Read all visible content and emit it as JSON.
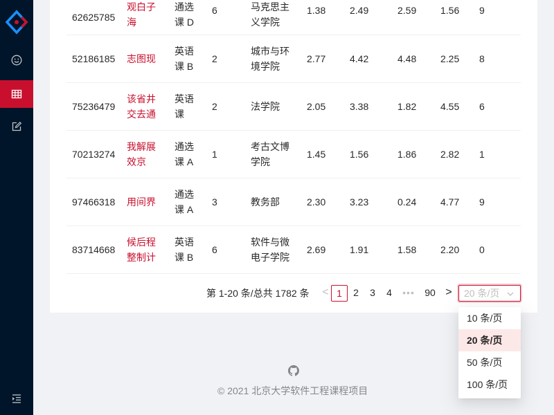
{
  "sidebar": {
    "logo_icon": "react-logo-icon",
    "items": [
      {
        "icon": "smile-icon",
        "active": false
      },
      {
        "icon": "table-icon",
        "active": true
      },
      {
        "icon": "edit-icon",
        "active": false
      }
    ],
    "collapse_icon": "menu-unfold-icon"
  },
  "colors": {
    "accent": "#c8102e",
    "sidebar": "#001529",
    "background": "#f0f2f5"
  },
  "table": {
    "rows": [
      {
        "id": "62625785",
        "name": "观白子海",
        "type": "通选课 D",
        "credit": "6",
        "dept": "马克思主义学院",
        "a": "1.38",
        "b": "2.49",
        "c": "2.59",
        "d": "1.56",
        "e": "9"
      },
      {
        "id": "52186185",
        "name": "志图现",
        "type": "英语课 B",
        "credit": "2",
        "dept": "城市与环境学院",
        "a": "2.77",
        "b": "4.42",
        "c": "4.48",
        "d": "2.25",
        "e": "8"
      },
      {
        "id": "75236479",
        "name": "该省井交去通",
        "type": "英语课",
        "credit": "2",
        "dept": "法学院",
        "a": "2.05",
        "b": "3.38",
        "c": "1.82",
        "d": "4.55",
        "e": "6"
      },
      {
        "id": "70213274",
        "name": "我解展效京",
        "type": "通选课 A",
        "credit": "1",
        "dept": "考古文博学院",
        "a": "1.45",
        "b": "1.56",
        "c": "1.86",
        "d": "2.82",
        "e": "1"
      },
      {
        "id": "97466318",
        "name": "用间界",
        "type": "通选课 A",
        "credit": "3",
        "dept": "教务部",
        "a": "2.30",
        "b": "3.23",
        "c": "0.24",
        "d": "4.77",
        "e": "9"
      },
      {
        "id": "83714668",
        "name": "候后程整制计",
        "type": "英语课 B",
        "credit": "6",
        "dept": "软件与微电子学院",
        "a": "2.69",
        "b": "1.91",
        "c": "1.58",
        "d": "2.20",
        "e": "0"
      }
    ]
  },
  "pagination": {
    "total_text": "第 1-20 条/总共 1782 条",
    "prev": "<",
    "pages": [
      "1",
      "2",
      "3",
      "4"
    ],
    "dots": "•••",
    "last": "90",
    "next": ">",
    "current": "1",
    "size_placeholder": "20 条/页"
  },
  "page_size_options": [
    "10 条/页",
    "20 条/页",
    "50 条/页",
    "100 条/页"
  ],
  "page_size_selected": "20 条/页",
  "footer": {
    "github_icon": "github-icon",
    "copyright": "© 2021 北京大学软件工程课程项目"
  }
}
